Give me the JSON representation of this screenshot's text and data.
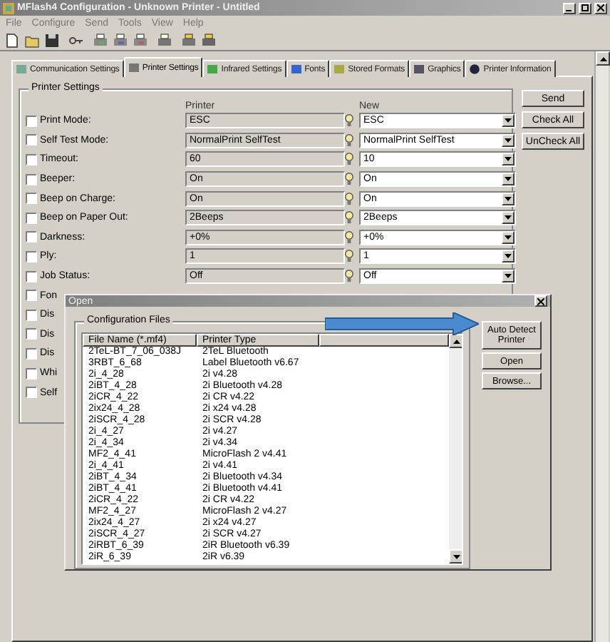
{
  "window": {
    "title": "MFlash4 Configuration - Unknown Printer - Untitled"
  },
  "menu": [
    "File",
    "Configure",
    "Send",
    "Tools",
    "View",
    "Help"
  ],
  "tabs": [
    {
      "label": "Communication Settings",
      "selected": false
    },
    {
      "label": "Printer Settings",
      "selected": true
    },
    {
      "label": "Infrared Settings",
      "selected": false
    },
    {
      "label": "Fonts",
      "selected": false
    },
    {
      "label": "Stored Formats",
      "selected": false
    },
    {
      "label": "Graphics",
      "selected": false
    },
    {
      "label": "Printer Information",
      "selected": false
    }
  ],
  "settings": {
    "title": "Printer Settings",
    "printer_header": "Printer",
    "new_header": "New",
    "rows": [
      {
        "label": "Print Mode:",
        "checked": false,
        "printer": "ESC",
        "new": "ESC"
      },
      {
        "label": "Self Test Mode:",
        "checked": false,
        "printer": "NormalPrint SelfTest",
        "new": "NormalPrint SelfTest"
      },
      {
        "label": "Timeout:",
        "checked": false,
        "printer": "60",
        "new": "10"
      },
      {
        "label": "Beeper:",
        "checked": false,
        "printer": "On",
        "new": "On"
      },
      {
        "label": "Beep on Charge:",
        "checked": false,
        "printer": "On",
        "new": "On"
      },
      {
        "label": "Beep on Paper Out:",
        "checked": false,
        "printer": "2Beeps",
        "new": "2Beeps"
      },
      {
        "label": "Darkness:",
        "checked": false,
        "printer": "+0%",
        "new": "+0%"
      },
      {
        "label": "Ply:",
        "checked": false,
        "printer": "1",
        "new": "1"
      },
      {
        "label": "Job Status:",
        "checked": false,
        "printer": "Off",
        "new": "Off"
      },
      {
        "label": "Fon",
        "checked": false
      },
      {
        "label": "Dis",
        "checked": false
      },
      {
        "label": "Dis",
        "checked": false
      },
      {
        "label": "Dis",
        "checked": false
      },
      {
        "label": "Whi",
        "checked": false
      },
      {
        "label": "Self",
        "checked": false
      }
    ]
  },
  "side_buttons": [
    "Send",
    "Check All",
    "UnCheck All"
  ],
  "dialog": {
    "title": "Open",
    "group": "Configuration Files",
    "columns": [
      "File Name (*.mf4)",
      "Printer Type"
    ],
    "rows": [
      [
        "2TeL-BT_7_06_038J",
        "2TeL Bluetooth"
      ],
      [
        "3RBT_6_68",
        "Label Bluetooth v6.67"
      ],
      [
        "2i_4_28",
        "2i v4.28"
      ],
      [
        "2iBT_4_28",
        "2i Bluetooth v4.28"
      ],
      [
        "2iCR_4_22",
        "2i CR v4.22"
      ],
      [
        "2ix24_4_28",
        "2i x24 v4.28"
      ],
      [
        "2iSCR_4_28",
        "2i SCR v4.28"
      ],
      [
        "2i_4_27",
        "2i v4.27"
      ],
      [
        "2i_4_34",
        "2i v4.34"
      ],
      [
        "MF2_4_41",
        "MicroFlash 2 v4.41"
      ],
      [
        "2i_4_41",
        "2i v4.41"
      ],
      [
        "2iBT_4_34",
        "2i Bluetooth v4.34"
      ],
      [
        "2iBT_4_41",
        "2i Bluetooth v4.41"
      ],
      [
        "2iCR_4_22",
        "2i CR v4.22"
      ],
      [
        "MF2_4_27",
        "MicroFlash 2 v4.27"
      ],
      [
        "2ix24_4_27",
        "2i x24 v4.27"
      ],
      [
        "2iSCR_4_27",
        "2i SCR v4.27"
      ],
      [
        "2iRBT_6_39",
        "2iR Bluetooth v6.39"
      ],
      [
        "2iR_6_39",
        "2iR v6.39"
      ]
    ],
    "buttons": [
      "Auto Detect Printer",
      "Open",
      "Browse..."
    ]
  }
}
